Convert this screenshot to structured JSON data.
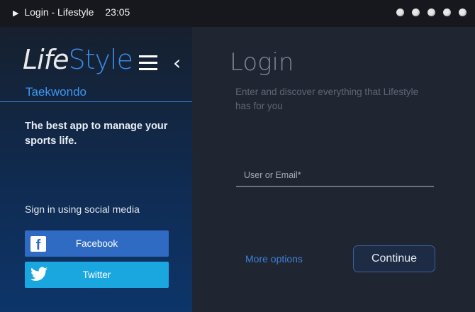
{
  "window": {
    "title": "Login - Lifestyle",
    "time": "23:05",
    "dot_count": 5
  },
  "sidebar": {
    "logo_part1": "Life",
    "logo_part2": "Style",
    "subtitle": "Taekwondo",
    "tagline": "The best app to manage your sports life.",
    "social_label": "Sign in using social media",
    "facebook_label": "Facebook",
    "twitter_label": "Twitter"
  },
  "login": {
    "title": "Login",
    "description": "Enter and discover everything that Lifestyle has for you",
    "user_placeholder": "User or Email*",
    "more_options": "More options",
    "continue": "Continue"
  },
  "colors": {
    "accent": "#3b88e6",
    "facebook": "#2f6bc3",
    "twitter": "#1aa7e0"
  }
}
